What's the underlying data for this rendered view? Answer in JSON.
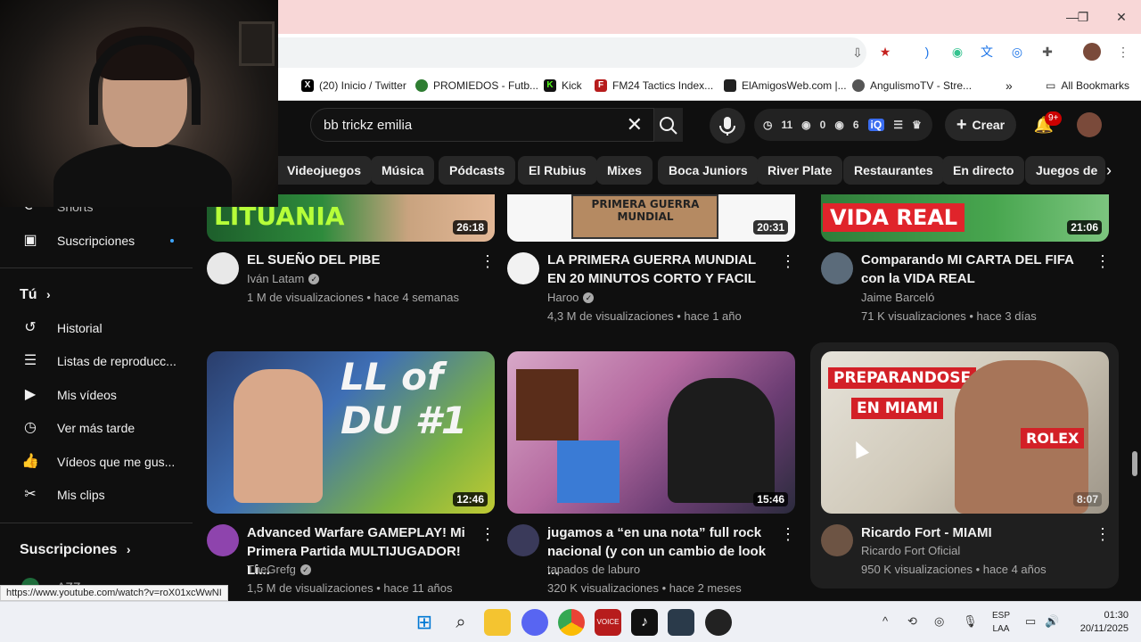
{
  "browser": {
    "bookmarks": [
      {
        "label": "(20) Inicio / Twitter",
        "icon": "x-icon"
      },
      {
        "label": "PROMIEDOS - Futb...",
        "icon": "promiedos-icon"
      },
      {
        "label": "Kick",
        "icon": "kick-icon"
      },
      {
        "label": "FM24 Tactics Index...",
        "icon": "fm-icon"
      },
      {
        "label": "ElAmigosWeb.com |...",
        "icon": "elamigos-icon"
      },
      {
        "label": "AngulismoTV - Stre...",
        "icon": "angulismo-icon"
      }
    ],
    "all_bookmarks": "All Bookmarks",
    "status_url": "https://www.youtube.com/watch?v=roX01xcWwNI"
  },
  "youtube": {
    "search_value": "bb trickz emilia",
    "stats": {
      "a": "11",
      "b": "0",
      "c": "6"
    },
    "create_label": "Crear",
    "notifications_badge": "9+",
    "chips": [
      "Videojuegos",
      "Música",
      "Pódcasts",
      "El Rubius",
      "Mixes",
      "Boca Juniors",
      "River Plate",
      "Restaurantes",
      "En directo",
      "Juegos de"
    ]
  },
  "sidebar": {
    "shorts": "Shorts",
    "subscriptions": "Suscripciones",
    "you_header": "Tú",
    "you_items": [
      {
        "label": "Historial",
        "icon": "history-icon"
      },
      {
        "label": "Listas de reproducc...",
        "icon": "playlist-icon"
      },
      {
        "label": "Mis vídeos",
        "icon": "my-videos-icon"
      },
      {
        "label": "Ver más tarde",
        "icon": "watch-later-icon"
      },
      {
        "label": "Vídeos que me gus...",
        "icon": "liked-icon"
      },
      {
        "label": "Mis clips",
        "icon": "clips-icon"
      }
    ],
    "subscriptions_header": "Suscripciones",
    "partial_channel": "AZZ"
  },
  "videos": [
    {
      "title": "EL SUEÑO DEL PIBE",
      "channel": "Iván Latam",
      "verified": true,
      "meta": "1 M de visualizaciones • hace 4 semanas",
      "duration": "26:18",
      "thumb_text": "LITUANIA"
    },
    {
      "title": "LA PRIMERA GUERRA MUNDIAL EN 20 MINUTOS CORTO Y FACIL",
      "channel": "Haroo",
      "verified": true,
      "meta": "4,3 M de visualizaciones • hace 1 año",
      "duration": "20:31",
      "thumb_text": "PRIMERA GUERRA MUNDIAL"
    },
    {
      "title": "Comparando MI CARTA DEL FIFA con la VIDA REAL",
      "channel": "Jaime Barceló",
      "verified": false,
      "meta": "71 K visualizaciones • hace 3 días",
      "duration": "21:06",
      "thumb_text": "VIDA REAL"
    },
    {
      "title": "Advanced Warfare GAMEPLAY! Mi Primera Partida MULTIJUGADOR! Li...",
      "channel": "TheGrefg",
      "verified": true,
      "meta": "1,5 M de visualizaciones • hace 11 años",
      "duration": "12:46",
      "thumb_text": "LL of DU #1"
    },
    {
      "title": "jugamos a “en una nota” full rock nacional (y con un cambio de look ...",
      "channel": "tapados de laburo",
      "verified": false,
      "meta": "320 K visualizaciones • hace 2 meses",
      "duration": "15:46",
      "thumb_text": ""
    },
    {
      "title": "Ricardo Fort - MIAMI",
      "channel": "Ricardo Fort Oficial",
      "verified": false,
      "meta": "950 K visualizaciones • hace 4 años",
      "duration": "8:07",
      "thumb_text_1": "PREPARANDOSE",
      "thumb_text_2": "EN MIAMI",
      "thumb_text_3": "ROLEX"
    }
  ],
  "taskbar": {
    "lang_1": "ESP",
    "lang_2": "LAA",
    "time": "01:30",
    "date": "20/11/2025"
  },
  "colors": {
    "youtube_bg": "#0f0f0f",
    "chip_bg": "#272727",
    "titlebar": "#f8d7d7",
    "badge": "#cc0000"
  }
}
